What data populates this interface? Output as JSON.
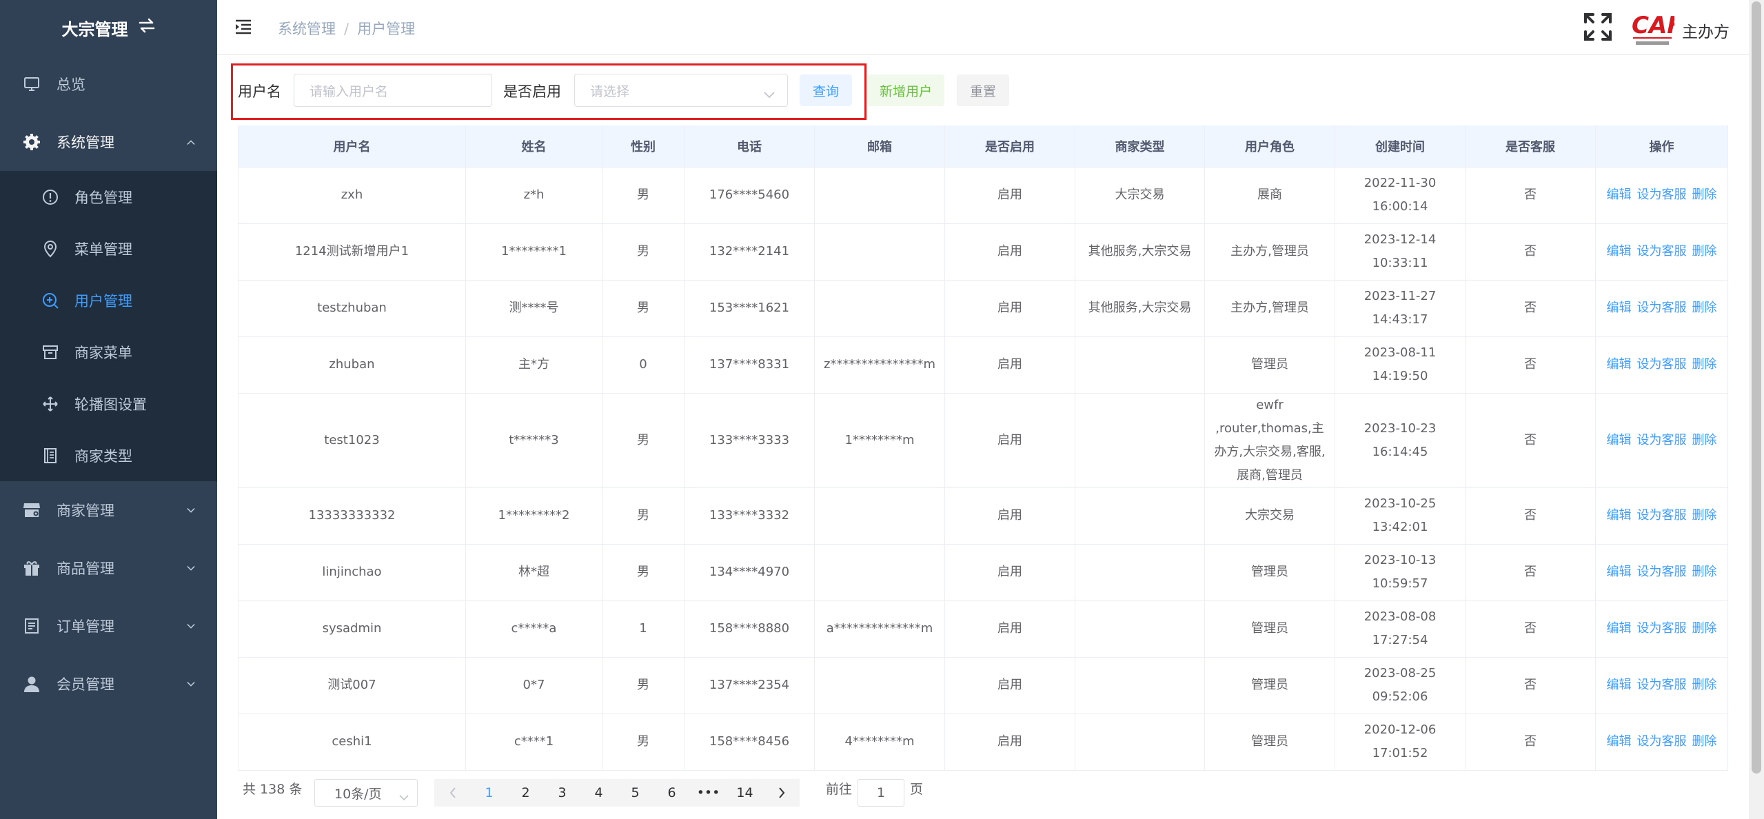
{
  "sidebar": {
    "title": "大宗管理",
    "items": [
      {
        "label": "总览",
        "icon": "monitor-icon"
      },
      {
        "label": "系统管理",
        "icon": "gear-icon"
      },
      {
        "label": "商家管理",
        "icon": "store-icon"
      },
      {
        "label": "商品管理",
        "icon": "gift-icon"
      },
      {
        "label": "订单管理",
        "icon": "document-icon"
      },
      {
        "label": "会员管理",
        "icon": "user-icon"
      }
    ],
    "sub_items": [
      {
        "label": "角色管理",
        "icon": "info-circle-icon"
      },
      {
        "label": "菜单管理",
        "icon": "location-pin-icon"
      },
      {
        "label": "用户管理",
        "icon": "zoom-in-icon"
      },
      {
        "label": "商家菜单",
        "icon": "box-icon"
      },
      {
        "label": "轮播图设置",
        "icon": "move-arrows-icon"
      },
      {
        "label": "商家类型",
        "icon": "notebook-icon"
      }
    ]
  },
  "header": {
    "breadcrumb": [
      "系统管理",
      "用户管理"
    ],
    "org_name": "主办方",
    "logo_text": "CAF"
  },
  "filter": {
    "username_label": "用户名",
    "username_placeholder": "请输入用户名",
    "enabled_label": "是否启用",
    "enabled_placeholder": "请选择",
    "search_btn": "查询",
    "add_btn": "新增用户",
    "reset_btn": "重置"
  },
  "table": {
    "headers": [
      "用户名",
      "姓名",
      "性别",
      "电话",
      "邮箱",
      "是否启用",
      "商家类型",
      "用户角色",
      "创建时间",
      "是否客服",
      "操作"
    ],
    "actions": [
      "编辑",
      "设为客服",
      "删除"
    ],
    "rows": [
      [
        "zxh",
        "z*h",
        "男",
        "176****5460",
        "",
        "启用",
        "大宗交易",
        "展商",
        "2022-11-30 16:00:14",
        "否"
      ],
      [
        "1214测试新增用户1",
        "1********1",
        "男",
        "132****2141",
        "",
        "启用",
        "其他服务,大宗交易",
        "主办方,管理员",
        "2023-12-14 10:33:11",
        "否"
      ],
      [
        "testzhuban",
        "测****号",
        "男",
        "153****1621",
        "",
        "启用",
        "其他服务,大宗交易",
        "主办方,管理员",
        "2023-11-27 14:43:17",
        "否"
      ],
      [
        "zhuban",
        "主*方",
        "0",
        "137****8331",
        "z***************m",
        "启用",
        "",
        "管理员",
        "2023-08-11 14:19:50",
        "否"
      ],
      [
        "test1023",
        "t******3",
        "男",
        "133****3333",
        "1********m",
        "启用",
        "",
        "ewfr ,router,thomas,主办方,大宗交易,客服,展商,管理员",
        "2023-10-23 16:14:45",
        "否"
      ],
      [
        "13333333332",
        "1*********2",
        "男",
        "133****3332",
        "",
        "启用",
        "",
        "大宗交易",
        "2023-10-25 13:42:01",
        "否"
      ],
      [
        "linjinchao",
        "林*超",
        "男",
        "134****4970",
        "",
        "启用",
        "",
        "管理员",
        "2023-10-13 10:59:57",
        "否"
      ],
      [
        "sysadmin",
        "c*****a",
        "1",
        "158****8880",
        "a**************m",
        "启用",
        "",
        "管理员",
        "2023-08-08 17:27:54",
        "否"
      ],
      [
        "测试007",
        "0*7",
        "男",
        "137****2354",
        "",
        "启用",
        "",
        "管理员",
        "2023-08-25 09:52:06",
        "否"
      ],
      [
        "ceshi1",
        "c****1",
        "男",
        "158****8456",
        "4********m",
        "启用",
        "",
        "管理员",
        "2020-12-06 17:01:52",
        "否"
      ]
    ]
  },
  "pagination": {
    "total": "共 138 条",
    "page_size": "10条/页",
    "pages": [
      "1",
      "2",
      "3",
      "4",
      "5",
      "6",
      "•••",
      "14"
    ],
    "current": "1",
    "goto_prefix": "前往",
    "goto_value": "1",
    "goto_suffix": "页"
  },
  "colors": {
    "sidebar_bg": "#304156",
    "submenu_bg": "#1f2d3d",
    "accent": "#409eff",
    "highlight_border": "#e02020"
  }
}
